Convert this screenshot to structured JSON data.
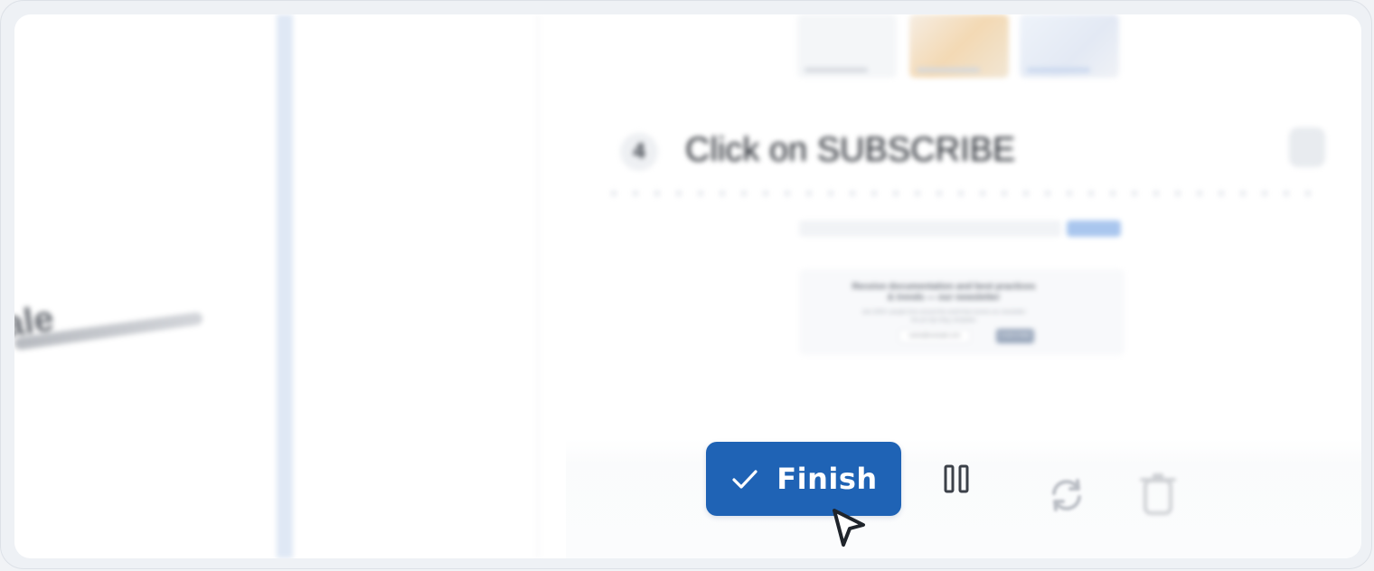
{
  "background": {
    "left_text": "ale",
    "step": {
      "number": "4",
      "title": "Click on SUBSCRIBE"
    },
    "newsletter": {
      "title_line1": "Receive documentation and best practices",
      "title_line2": "& trends — our newsletter",
      "subtitle_line1": "Join 3000+ people from around the world that receive our newsletter",
      "subtitle_line2": "the pro tips blog, templates",
      "input_value": "name@example.com",
      "button_label": "SUBSCRIBE"
    }
  },
  "controls": {
    "finish_label": "Finish",
    "accent_color": "#1f63b5",
    "icons": [
      "check-icon",
      "pause-icon",
      "rotate-icon",
      "trash-icon"
    ]
  },
  "cursor": {
    "icon": "arrow-cursor-icon"
  }
}
